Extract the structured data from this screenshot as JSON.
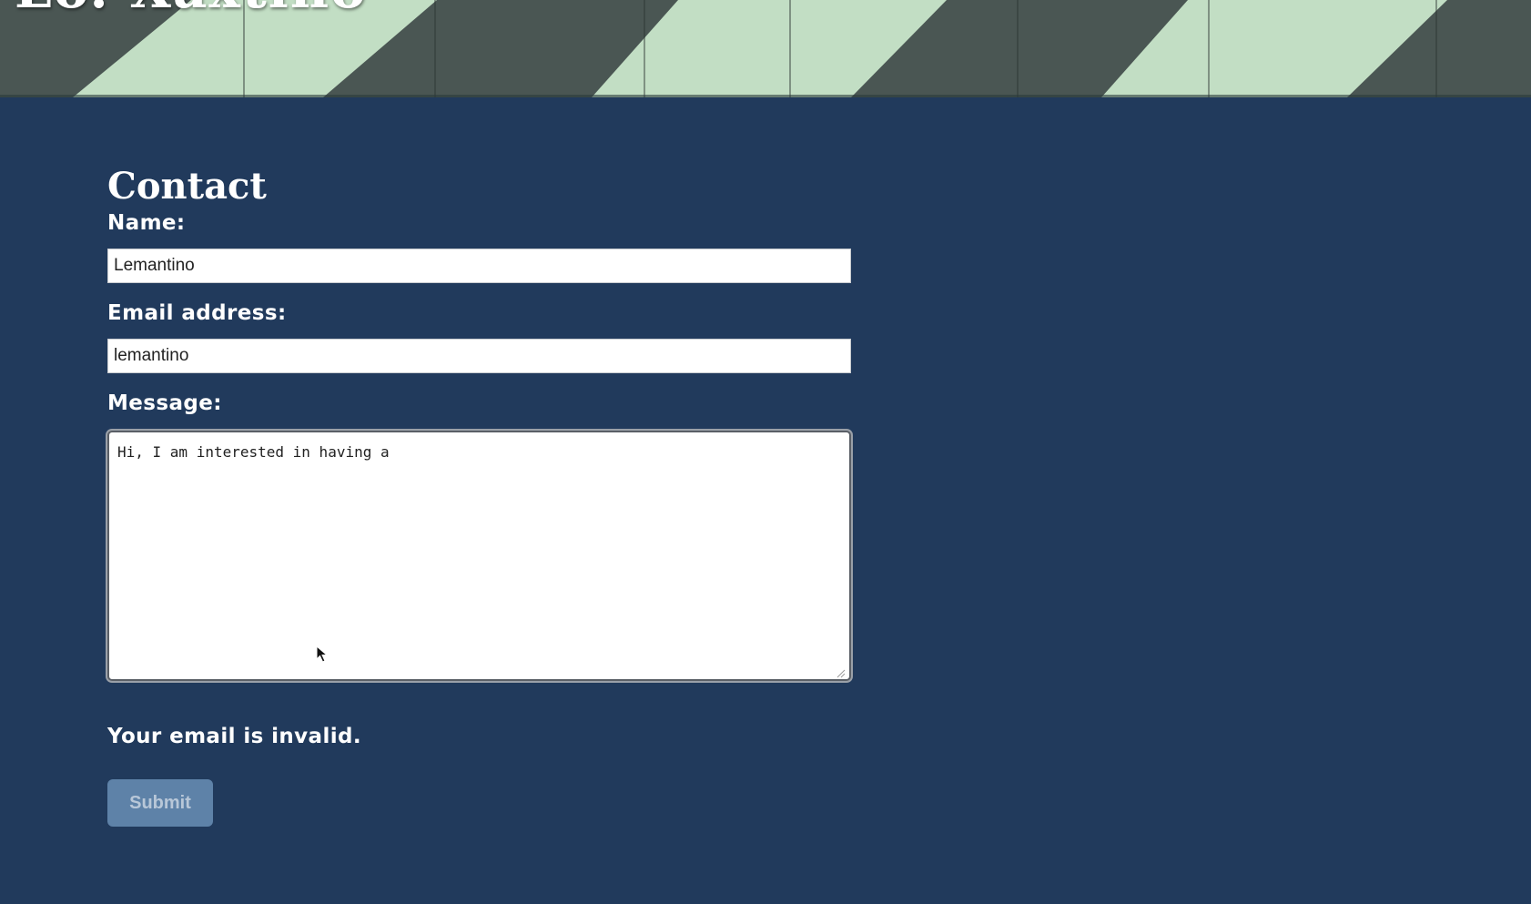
{
  "banner": {
    "title": "Lo. Xaxtino"
  },
  "form": {
    "heading": "Contact",
    "name_label": "Name:",
    "name_value": "Lemantino",
    "email_label": "Email address:",
    "email_value": "lemantino",
    "message_label": "Message:",
    "message_value": "Hi, I am interested in having a",
    "error_message": "Your email is invalid.",
    "submit_label": "Submit"
  },
  "colors": {
    "page_background": "#213a5c",
    "banner_stripe_light": "#c2dec4",
    "banner_stripe_dark": "#4a5653",
    "submit_background": "#5e82a8",
    "submit_text": "#b8c7d8",
    "text": "#ffffff"
  },
  "icons": {
    "pointer": "mouse-pointer-icon",
    "resize": "resize-grip-icon"
  }
}
